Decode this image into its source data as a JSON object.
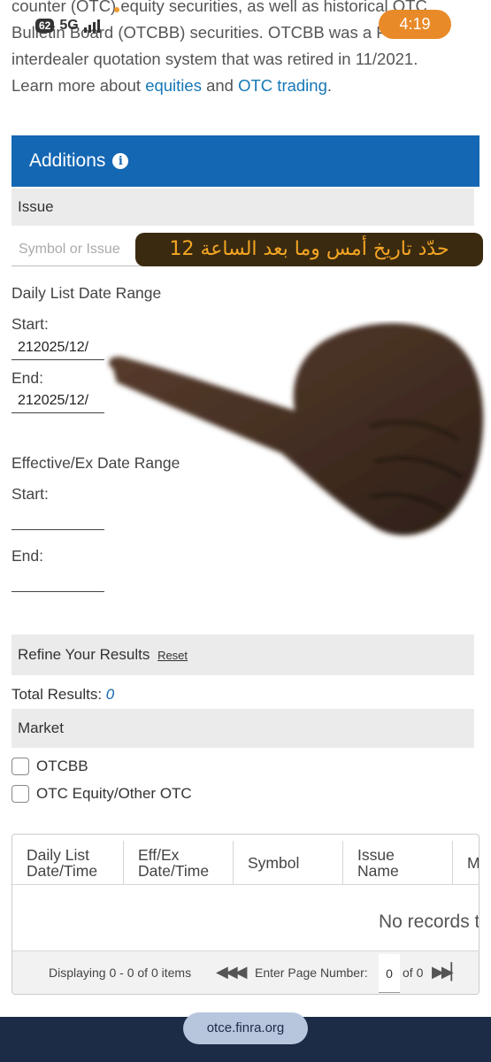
{
  "status_bar": {
    "badge": "62",
    "network": "5G",
    "time": "4:19"
  },
  "intro": {
    "line1": "counter (OTC) equity securities, as well as historical OTC",
    "line2": "Bulletin Board (OTCBB) securities. OTCBB was a FINRA",
    "line3": "interdealer quotation system that was retired in 11/2021.",
    "line4_prefix": "Learn more about ",
    "link_equities": "equities",
    "line4_mid": " and ",
    "link_otc": "OTC trading",
    "line4_suffix": "."
  },
  "panel": {
    "title": "Additions",
    "info_icon": "i"
  },
  "issue": {
    "label": "Issue",
    "placeholder": "Symbol or Issue"
  },
  "overlay_caption": "حدّد تاريخ أمس وما بعد الساعة 12",
  "daily_list": {
    "label": "Daily List Date Range",
    "start_label": "Start:",
    "start_value": "212025/12/",
    "end_label": "End:",
    "end_value": "212025/12/"
  },
  "effective": {
    "label": "Effective/Ex Date Range",
    "start_label": "Start:",
    "start_value": "",
    "end_label": "End:",
    "end_value": ""
  },
  "refine": {
    "title": "Refine Your Results",
    "reset": "Reset"
  },
  "total": {
    "label": "Total Results: ",
    "value": "0"
  },
  "market": {
    "title": "Market",
    "options": [
      {
        "label": "OTCBB",
        "checked": false
      },
      {
        "label": "OTC Equity/Other OTC",
        "checked": false
      }
    ]
  },
  "grid": {
    "columns": [
      "Daily List\nDate/Time",
      "Eff/Ex\nDate/Time",
      "Symbol",
      "Issue\nName",
      "M"
    ],
    "empty_text": "No records t",
    "pager": {
      "displaying": "Displaying 0 - 0 of 0 items",
      "first_prev": "◀◀◀",
      "enter_label": "Enter Page Number:",
      "page_value": "0",
      "of_label": "of 0",
      "next_last": "▶▶▏"
    }
  },
  "footer": {
    "url": "otce.finra.org"
  },
  "colors": {
    "header_blue": "#1467b3",
    "link": "#1677b6",
    "caption_bg": "#3a2a10",
    "caption_text": "#f5a623",
    "time_pill": "#e98a28",
    "footer": "#1c2b46"
  },
  "icons": [
    "info-icon",
    "pointing-hand-icon",
    "first-page-icon",
    "prev-page-icon",
    "next-page-icon",
    "last-page-icon"
  ]
}
